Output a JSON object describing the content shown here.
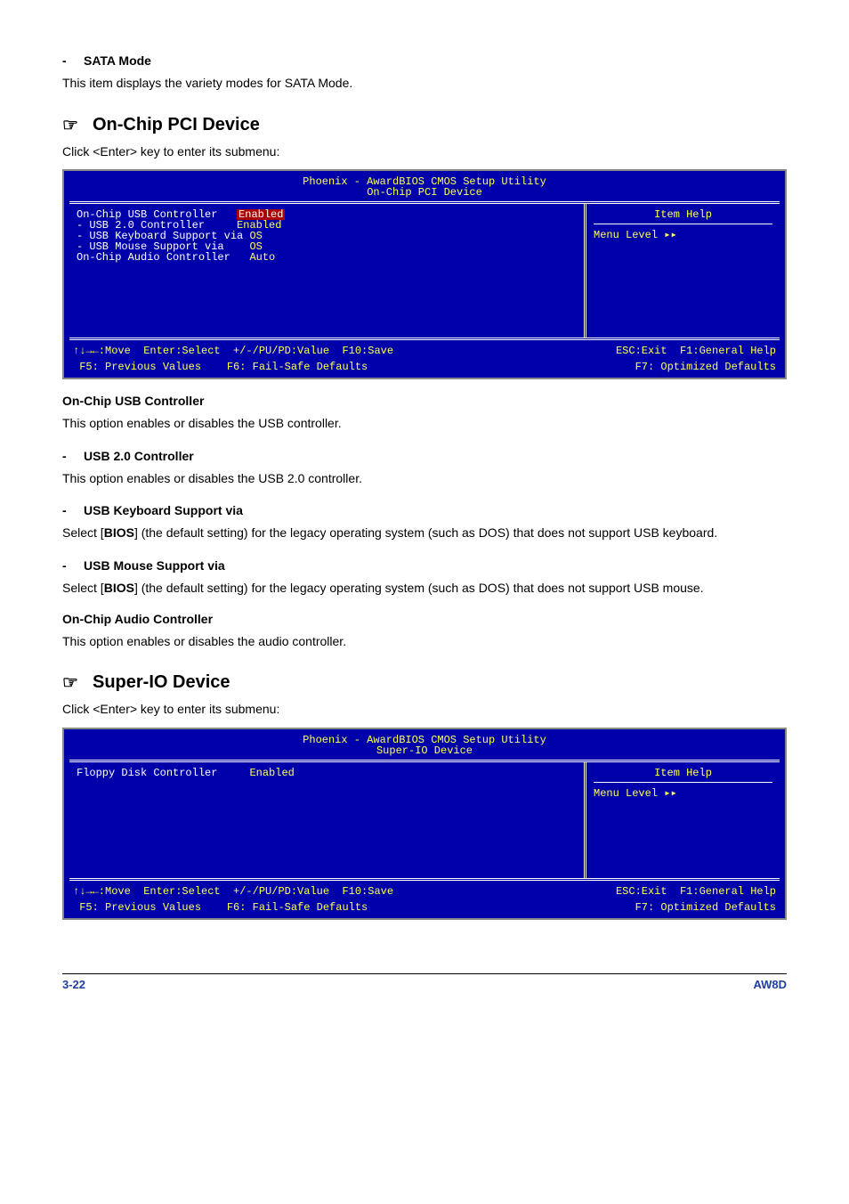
{
  "sataMode": {
    "title": "SATA Mode",
    "desc": "This item displays the variety modes for SATA Mode."
  },
  "onChipPci": {
    "heading": "On-Chip PCI Device",
    "intro": "Click <Enter> key to enter its submenu:",
    "bios": {
      "titleA": "Phoenix - AwardBIOS CMOS Setup Utility",
      "titleB": "On-Chip PCI Device",
      "rows": [
        {
          "label": "On-Chip USB Controller",
          "val": "Enabled",
          "sel": true
        },
        {
          "label": "- USB 2.0 Controller",
          "val": "Enabled"
        },
        {
          "label": "- USB Keyboard Support via",
          "val": "OS"
        },
        {
          "label": "- USB Mouse Support via",
          "val": "OS"
        },
        {
          "label": "On-Chip Audio Controller",
          "val": "Auto"
        }
      ],
      "helpTitle": "Item Help",
      "menuLevel": "Menu Level   ▸▸",
      "keysLeftA": "↑↓→←:Move  Enter:Select  +/-/PU/PD:Value  F10:Save",
      "keysRightA": "ESC:Exit  F1:General Help",
      "keysLeftB": " F5: Previous Values    F6: Fail-Safe Defaults",
      "keysRightB": "F7: Optimized Defaults"
    },
    "usbController": {
      "title": "On-Chip USB Controller",
      "desc": "This option enables or disables the USB controller."
    },
    "usb20": {
      "title": "USB 2.0 Controller",
      "desc": "This option enables or disables the USB 2.0 controller."
    },
    "usbKeyboard": {
      "title": "USB Keyboard Support via",
      "descPre": "Select [",
      "bios": "BIOS",
      "descPost": "] (the default setting) for the legacy operating system (such as DOS) that does not support USB keyboard."
    },
    "usbMouse": {
      "title": "USB Mouse Support via",
      "descPre": "Select [",
      "bios": "BIOS",
      "descPost": "] (the default setting) for the legacy operating system (such as DOS) that does not support USB mouse."
    },
    "audio": {
      "title": "On-Chip Audio Controller",
      "desc": "This option enables or disables the audio controller."
    }
  },
  "superIo": {
    "heading": "Super-IO Device",
    "intro": "Click <Enter> key to enter its submenu:",
    "bios": {
      "titleA": "Phoenix - AwardBIOS CMOS Setup Utility",
      "titleB": "Super-IO Device",
      "rows": [
        {
          "label": "Floppy Disk Controller",
          "val": "Enabled"
        }
      ],
      "helpTitle": "Item Help",
      "menuLevel": "Menu Level   ▸▸",
      "keysLeftA": "↑↓→←:Move  Enter:Select  +/-/PU/PD:Value  F10:Save",
      "keysRightA": "ESC:Exit  F1:General Help",
      "keysLeftB": " F5: Previous Values    F6: Fail-Safe Defaults",
      "keysRightB": "F7: Optimized Defaults"
    }
  },
  "footer": {
    "page": "3-22",
    "model": "AW8D"
  }
}
